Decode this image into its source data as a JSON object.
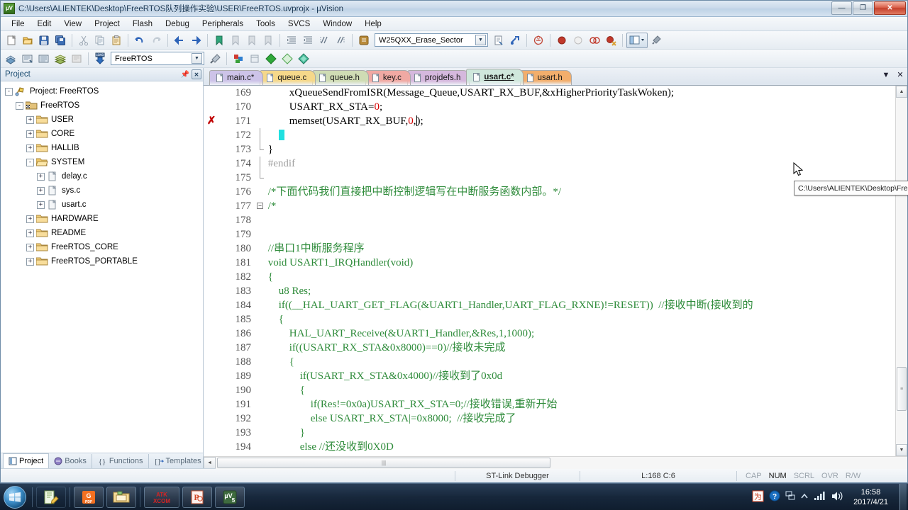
{
  "window": {
    "title": "C:\\Users\\ALIENTEK\\Desktop\\FreeRTOS队列操作实验\\USER\\FreeRTOS.uvprojx - µVision",
    "icon": "uvision-logo-icon",
    "minimize_label": "—",
    "maximize_label": "❐",
    "close_label": "✕"
  },
  "menubar": {
    "items": [
      {
        "label": "File"
      },
      {
        "label": "Edit"
      },
      {
        "label": "View"
      },
      {
        "label": "Project"
      },
      {
        "label": "Flash"
      },
      {
        "label": "Debug"
      },
      {
        "label": "Peripherals"
      },
      {
        "label": "Tools"
      },
      {
        "label": "SVCS"
      },
      {
        "label": "Window"
      },
      {
        "label": "Help"
      }
    ]
  },
  "toolbar_main": {
    "buttons": [
      {
        "name": "new-file-icon"
      },
      {
        "name": "open-file-icon"
      },
      {
        "name": "save-icon"
      },
      {
        "name": "save-all-icon"
      },
      {
        "name": "cut-icon"
      },
      {
        "name": "copy-icon"
      },
      {
        "name": "paste-icon"
      },
      {
        "name": "undo-icon"
      },
      {
        "name": "redo-icon"
      },
      {
        "name": "navigate-back-icon"
      },
      {
        "name": "navigate-forward-icon"
      },
      {
        "name": "bookmark-toggle-icon"
      },
      {
        "name": "bookmark-prev-icon"
      },
      {
        "name": "bookmark-next-icon"
      },
      {
        "name": "bookmark-clear-icon"
      },
      {
        "name": "indent-increase-icon"
      },
      {
        "name": "indent-decrease-icon"
      },
      {
        "name": "comment-icon"
      },
      {
        "name": "uncomment-icon"
      }
    ],
    "function_combo": {
      "value": "W25QXX_Erase_Sector",
      "name": "function-navigation-combo"
    },
    "after_buttons": [
      {
        "name": "configure-window-icon"
      },
      {
        "name": "find-in-files-icon"
      },
      {
        "name": "browse-symbol-icon"
      },
      {
        "name": "insert-breakpoint-icon"
      },
      {
        "name": "kill-breakpoint-icon"
      },
      {
        "name": "disable-breakpoint-icon"
      },
      {
        "name": "kill-all-breakpoints-icon"
      },
      {
        "name": "window-layout-icon"
      },
      {
        "name": "configuration-wizard-icon"
      }
    ]
  },
  "toolbar_build": {
    "buttons": [
      {
        "name": "translate-file-icon"
      },
      {
        "name": "build-target-icon"
      },
      {
        "name": "rebuild-all-icon"
      },
      {
        "name": "batch-build-icon"
      },
      {
        "name": "stop-build-icon"
      },
      {
        "name": "download-to-flash-icon"
      }
    ],
    "target_combo": {
      "value": "FreeRTOS",
      "name": "select-target-combo"
    },
    "after_buttons": [
      {
        "name": "target-options-icon"
      },
      {
        "name": "manage-run-time-environment-icon"
      },
      {
        "name": "pack-installer-icon"
      },
      {
        "name": "multi-project-icon"
      },
      {
        "name": "new-component-icon"
      },
      {
        "name": "manage-components-icon"
      }
    ]
  },
  "project_panel": {
    "title": "Project",
    "pin_icon": "pin-icon",
    "close_icon": "close-icon",
    "tree": [
      {
        "label": "Project: FreeRTOS",
        "indent": 0,
        "expander": "-",
        "icon": "project-icon"
      },
      {
        "label": "FreeRTOS",
        "indent": 1,
        "expander": "-",
        "icon": "target-icon"
      },
      {
        "label": "USER",
        "indent": 2,
        "expander": "+",
        "icon": "folder-icon"
      },
      {
        "label": "CORE",
        "indent": 2,
        "expander": "+",
        "icon": "folder-icon"
      },
      {
        "label": "HALLIB",
        "indent": 2,
        "expander": "+",
        "icon": "folder-icon"
      },
      {
        "label": "SYSTEM",
        "indent": 2,
        "expander": "-",
        "icon": "folder-open-icon"
      },
      {
        "label": "delay.c",
        "indent": 3,
        "expander": "+",
        "icon": "c-file-icon"
      },
      {
        "label": "sys.c",
        "indent": 3,
        "expander": "+",
        "icon": "c-file-icon"
      },
      {
        "label": "usart.c",
        "indent": 3,
        "expander": "+",
        "icon": "c-file-icon"
      },
      {
        "label": "HARDWARE",
        "indent": 2,
        "expander": "+",
        "icon": "folder-icon"
      },
      {
        "label": "README",
        "indent": 2,
        "expander": "+",
        "icon": "folder-icon"
      },
      {
        "label": "FreeRTOS_CORE",
        "indent": 2,
        "expander": "+",
        "icon": "folder-icon"
      },
      {
        "label": "FreeRTOS_PORTABLE",
        "indent": 2,
        "expander": "+",
        "icon": "folder-icon"
      }
    ],
    "tabs": [
      {
        "label": "Project",
        "icon": "project-tab-icon",
        "active": true
      },
      {
        "label": "Books",
        "icon": "books-tab-icon",
        "active": false
      },
      {
        "label": "Functions",
        "icon": "functions-tab-icon",
        "active": false
      },
      {
        "label": "Templates",
        "icon": "templates-tab-icon",
        "active": false
      }
    ]
  },
  "editor": {
    "tabs": [
      {
        "label": "main.c*",
        "color": "#cdc3e8",
        "active": false
      },
      {
        "label": "queue.c",
        "color": "#f5d88a",
        "active": false
      },
      {
        "label": "queue.h",
        "color": "#cfdcb4",
        "active": false
      },
      {
        "label": "key.c",
        "color": "#f0a9a3",
        "active": false
      },
      {
        "label": "projdefs.h",
        "color": "#d5b8dd",
        "active": false
      },
      {
        "label": "usart.c*",
        "color": "#cfe7dc",
        "active": true
      },
      {
        "label": "usart.h",
        "color": "#f2ae6c",
        "active": false
      }
    ],
    "tab_dropdown_icon": "chevron-down-icon",
    "tab_close_icon": "close-icon",
    "tooltip": "C:\\Users\\ALIENTEK\\Desktop\\FreeRTOS队列操作实验\\SYSTEM\\usart\\usart.h",
    "first_line_number": 169,
    "lines": [
      {
        "n": 169,
        "indent": 8,
        "fold": "none",
        "marker": "",
        "spans": [
          {
            "t": "xQueueSendFromISR(Message_Queue,USART_RX_BUF,&xHigherPriorityTaskWoken);",
            "c": "plain"
          }
        ]
      },
      {
        "n": 170,
        "indent": 8,
        "fold": "none",
        "marker": "",
        "spans": [
          {
            "t": "USART_RX_STA=",
            "c": "plain"
          },
          {
            "t": "0",
            "c": "num"
          },
          {
            "t": ";",
            "c": "plain"
          }
        ]
      },
      {
        "n": 171,
        "indent": 8,
        "fold": "none",
        "marker": "error",
        "spans": [
          {
            "t": "memset(USART_RX_BUF,",
            "c": "plain"
          },
          {
            "t": "0",
            "c": "num"
          },
          {
            "t": ",",
            "c": "plain"
          },
          {
            "t": "CARET",
            "c": "caret"
          },
          {
            "t": ");",
            "c": "plain"
          }
        ]
      },
      {
        "n": 172,
        "indent": 4,
        "fold": "line",
        "marker": "",
        "spans": [
          {
            "t": "BLOCK",
            "c": "block"
          }
        ]
      },
      {
        "n": 173,
        "indent": 0,
        "fold": "end",
        "marker": "",
        "spans": [
          {
            "t": "}",
            "c": "plain"
          }
        ]
      },
      {
        "n": 174,
        "indent": 0,
        "fold": "line2",
        "marker": "",
        "spans": [
          {
            "t": "#endif",
            "c": "pre"
          }
        ]
      },
      {
        "n": 175,
        "indent": 0,
        "fold": "end2",
        "marker": "",
        "spans": []
      },
      {
        "n": 176,
        "indent": 0,
        "fold": "none",
        "marker": "",
        "spans": [
          {
            "t": "/*下面代码我们直接把中断控制逻辑写在中断服务函数内部。*/",
            "c": "cmt"
          }
        ]
      },
      {
        "n": 177,
        "indent": 0,
        "fold": "start",
        "marker": "",
        "spans": [
          {
            "t": "/*",
            "c": "cmt"
          }
        ]
      },
      {
        "n": 178,
        "indent": 0,
        "fold": "none",
        "marker": "",
        "spans": []
      },
      {
        "n": 179,
        "indent": 0,
        "fold": "none",
        "marker": "",
        "spans": []
      },
      {
        "n": 180,
        "indent": 0,
        "fold": "none",
        "marker": "",
        "spans": [
          {
            "t": "//串口1中断服务程序",
            "c": "cmt"
          }
        ]
      },
      {
        "n": 181,
        "indent": 0,
        "fold": "none",
        "marker": "",
        "spans": [
          {
            "t": "void USART1_IRQHandler(void)",
            "c": "cmt"
          }
        ]
      },
      {
        "n": 182,
        "indent": 0,
        "fold": "none",
        "marker": "",
        "spans": [
          {
            "t": "{",
            "c": "cmt"
          }
        ]
      },
      {
        "n": 183,
        "indent": 4,
        "fold": "none",
        "marker": "",
        "spans": [
          {
            "t": "u8 Res;",
            "c": "cmt"
          }
        ]
      },
      {
        "n": 184,
        "indent": 4,
        "fold": "none",
        "marker": "",
        "spans": [
          {
            "t": "if((__HAL_UART_GET_FLAG(&UART1_Handler,UART_FLAG_RXNE)!=RESET))  //接收中断(接收到的",
            "c": "cmt"
          }
        ]
      },
      {
        "n": 185,
        "indent": 4,
        "fold": "none",
        "marker": "",
        "spans": [
          {
            "t": "{",
            "c": "cmt"
          }
        ]
      },
      {
        "n": 186,
        "indent": 8,
        "fold": "none",
        "marker": "",
        "spans": [
          {
            "t": "HAL_UART_Receive(&UART1_Handler,&Res,1,1000);",
            "c": "cmt"
          }
        ]
      },
      {
        "n": 187,
        "indent": 8,
        "fold": "none",
        "marker": "",
        "spans": [
          {
            "t": "if((USART_RX_STA&0x8000)==0)//接收未完成",
            "c": "cmt"
          }
        ]
      },
      {
        "n": 188,
        "indent": 8,
        "fold": "none",
        "marker": "",
        "spans": [
          {
            "t": "{",
            "c": "cmt"
          }
        ]
      },
      {
        "n": 189,
        "indent": 12,
        "fold": "none",
        "marker": "",
        "spans": [
          {
            "t": "if(USART_RX_STA&0x4000)//接收到了0x0d",
            "c": "cmt"
          }
        ]
      },
      {
        "n": 190,
        "indent": 12,
        "fold": "none",
        "marker": "",
        "spans": [
          {
            "t": "{",
            "c": "cmt"
          }
        ]
      },
      {
        "n": 191,
        "indent": 16,
        "fold": "none",
        "marker": "",
        "spans": [
          {
            "t": "if(Res!=0x0a)USART_RX_STA=0;//接收错误,重新开始",
            "c": "cmt"
          }
        ]
      },
      {
        "n": 192,
        "indent": 16,
        "fold": "none",
        "marker": "",
        "spans": [
          {
            "t": "else USART_RX_STA|=0x8000;  //接收完成了",
            "c": "cmt"
          }
        ]
      },
      {
        "n": 193,
        "indent": 12,
        "fold": "none",
        "marker": "",
        "spans": [
          {
            "t": "}",
            "c": "cmt"
          }
        ]
      },
      {
        "n": 194,
        "indent": 12,
        "fold": "none",
        "marker": "",
        "spans": [
          {
            "t": "else //还没收到0X0D",
            "c": "cmt"
          }
        ]
      }
    ]
  },
  "statusbar": {
    "debugger": "ST-Link Debugger",
    "position": "L:168 C:6",
    "flags": [
      {
        "label": "CAP",
        "on": false
      },
      {
        "label": "NUM",
        "on": true
      },
      {
        "label": "SCRL",
        "on": false
      },
      {
        "label": "OVR",
        "on": false
      },
      {
        "label": "R/W",
        "on": false
      }
    ]
  },
  "taskbar": {
    "start_icon": "windows-start-icon",
    "items": [
      {
        "name": "notepadpp-icon",
        "label": "N++"
      },
      {
        "name": "foxit-pdf-icon",
        "label": "PDF"
      },
      {
        "name": "file-explorer-icon",
        "label": ""
      },
      {
        "name": "atk-xcom-icon",
        "label": "ATK XCOM"
      },
      {
        "name": "powerpoint-icon",
        "label": "P"
      },
      {
        "name": "uvision-taskbar-icon",
        "label": "V5"
      }
    ],
    "tray": [
      {
        "name": "sogou-input-icon"
      },
      {
        "name": "help-icon"
      },
      {
        "name": "network-tray-icon"
      },
      {
        "name": "show-hidden-icons-icon"
      },
      {
        "name": "signal-icon"
      },
      {
        "name": "volume-icon"
      }
    ],
    "clock_time": "16:58",
    "clock_date": "2017/4/21"
  }
}
